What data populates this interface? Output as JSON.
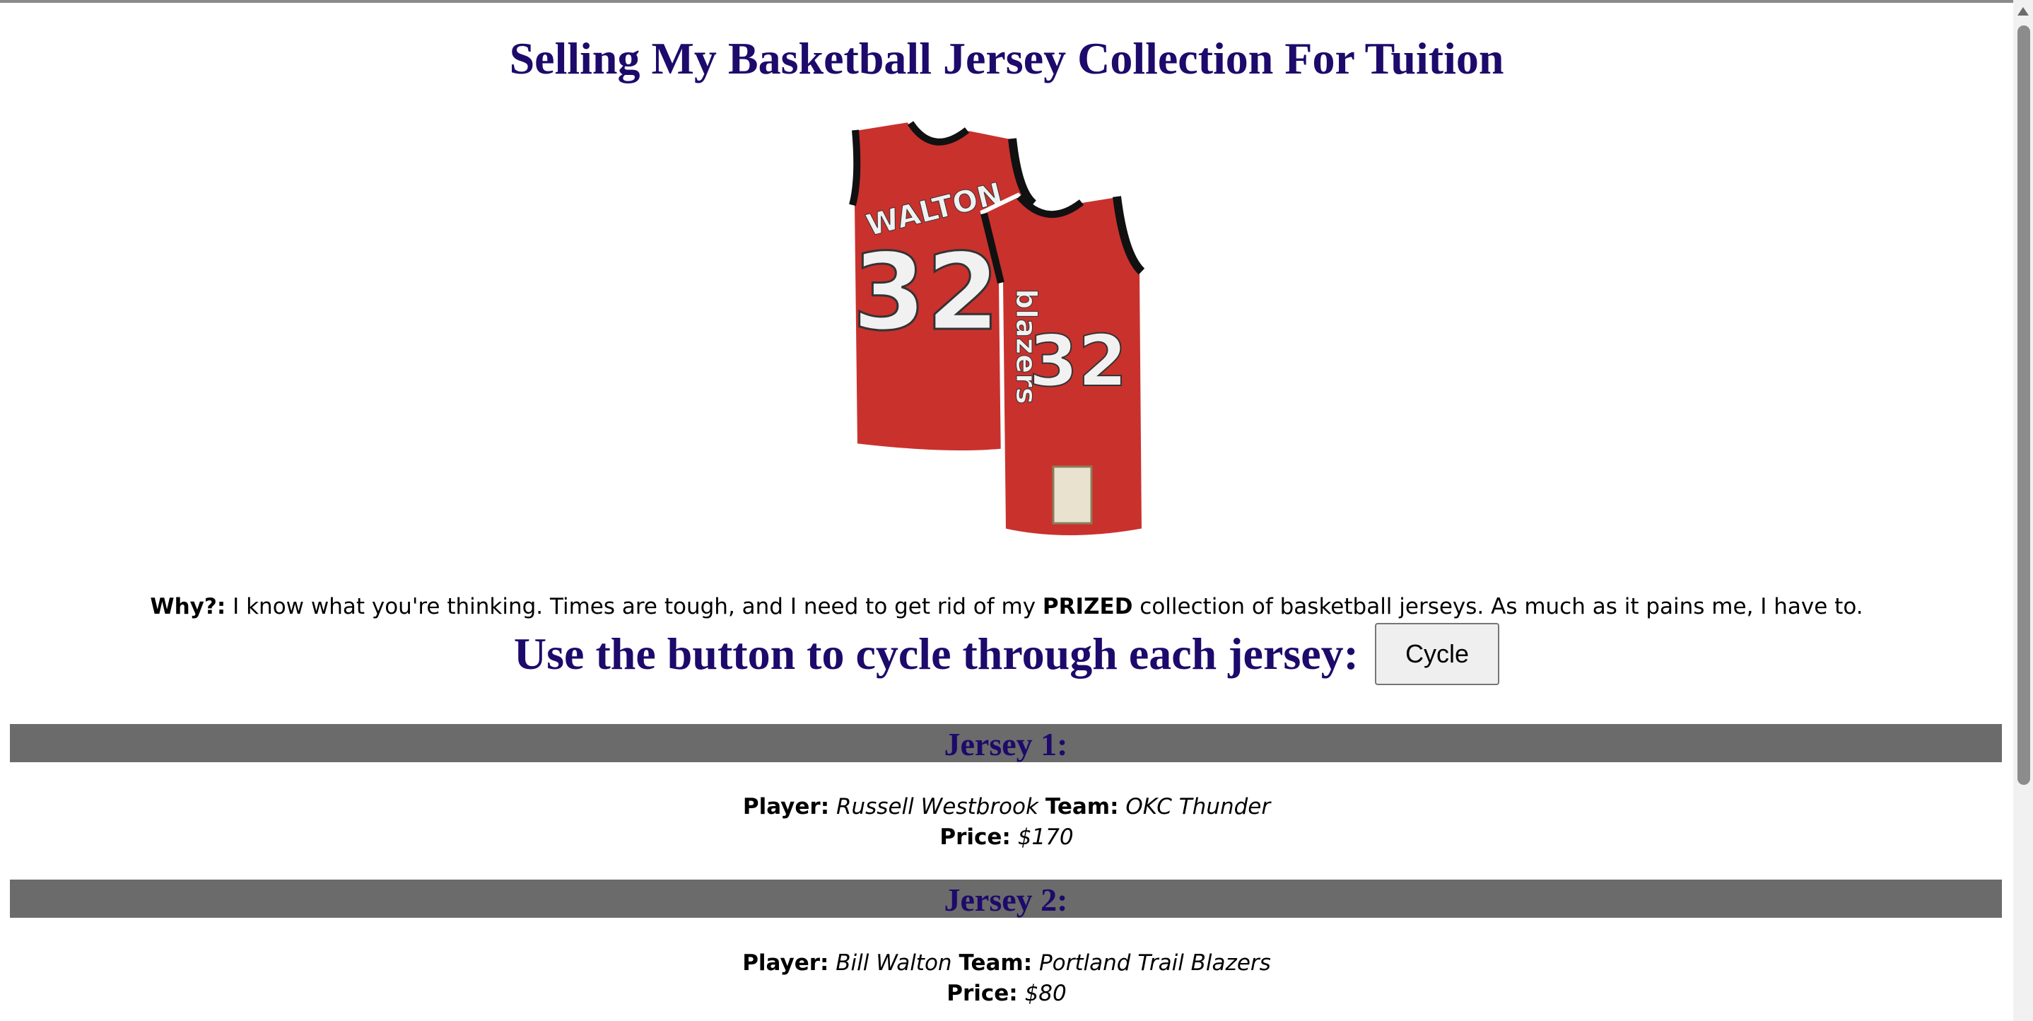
{
  "page": {
    "title": "Selling My Basketball Jersey Collection For Tuition",
    "hero_image_alt": "Walton 32 jersey",
    "hero_jersey": {
      "back_name": "WALTON",
      "back_number": "32",
      "front_number": "32",
      "front_text": "blazers"
    }
  },
  "why": {
    "label": "Why?:",
    "text_before": "I know what you're thinking. Times are tough, and I need to get rid of my",
    "emphasis": "PRIZED",
    "text_after": "collection of basketball jerseys. As much as it pains me, I have to."
  },
  "cycle": {
    "heading": "Use the button to cycle through each jersey:",
    "button_label": "Cycle"
  },
  "labels": {
    "player": "Player:",
    "team": "Team:",
    "price": "Price:"
  },
  "jerseys": [
    {
      "heading": "Jersey 1:",
      "player": "Russell Westbrook",
      "team": "OKC Thunder",
      "price": "$170"
    },
    {
      "heading": "Jersey 2:",
      "player": "Bill Walton",
      "team": "Portland Trail Blazers",
      "price": "$80"
    }
  ],
  "colors": {
    "heading": "#1d0a6b",
    "jersey_bar": "#6b6b6b",
    "jersey_red": "#c9312d"
  }
}
